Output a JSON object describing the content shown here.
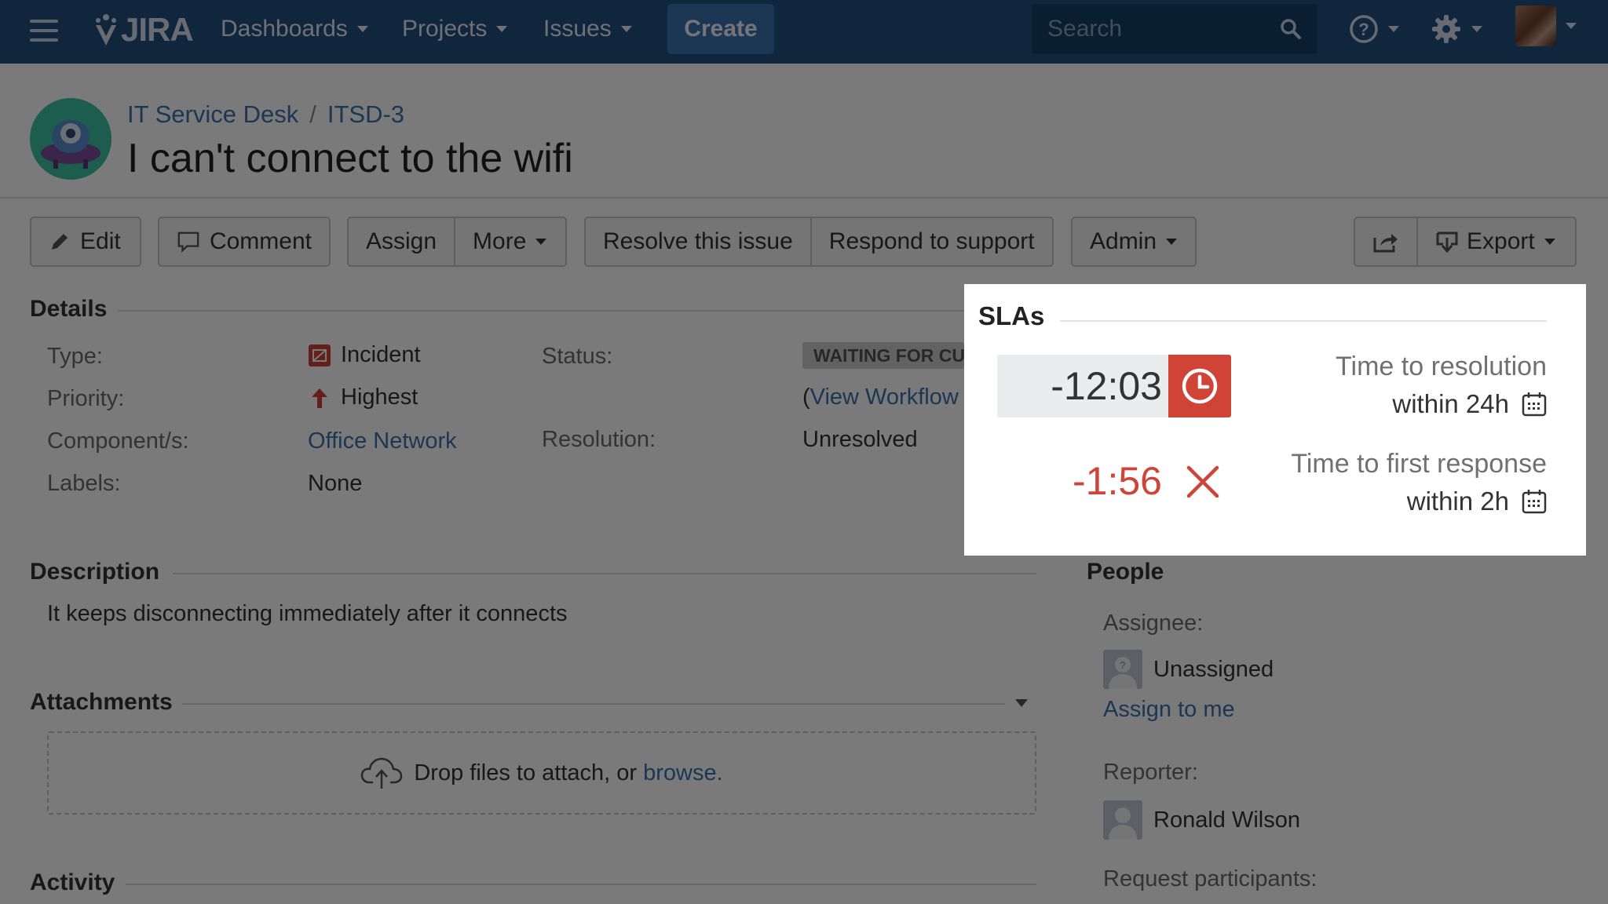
{
  "nav": {
    "logo_text": "JIRA",
    "dashboards": "Dashboards",
    "projects": "Projects",
    "issues": "Issues",
    "create": "Create",
    "search_placeholder": "Search"
  },
  "issue": {
    "project": "IT Service Desk",
    "key": "ITSD-3",
    "title": "I can't connect to the wifi"
  },
  "toolbar": {
    "edit": "Edit",
    "comment": "Comment",
    "assign": "Assign",
    "more": "More",
    "resolve": "Resolve this issue",
    "respond": "Respond to support",
    "admin": "Admin",
    "export": "Export"
  },
  "details": {
    "heading": "Details",
    "type_label": "Type:",
    "type_value": "Incident",
    "priority_label": "Priority:",
    "priority_value": "Highest",
    "components_label": "Component/s:",
    "components_value": "Office Network",
    "labels_label": "Labels:",
    "labels_value": "None",
    "status_label": "Status:",
    "status_value": "WAITING FOR CU",
    "view_workflow_prefix": "(",
    "view_workflow": "View Workflow",
    "resolution_label": "Resolution:",
    "resolution_value": "Unresolved"
  },
  "description": {
    "heading": "Description",
    "text": "It keeps disconnecting immediately after it connects"
  },
  "attachments": {
    "heading": "Attachments",
    "drop_text": "Drop files to attach, or ",
    "browse": "browse."
  },
  "activity": {
    "heading": "Activity"
  },
  "people": {
    "heading": "People",
    "assignee_label": "Assignee:",
    "assignee_value": "Unassigned",
    "assign_to_me": "Assign to me",
    "reporter_label": "Reporter:",
    "reporter_value": "Ronald Wilson",
    "participants_label": "Request participants:"
  },
  "slas": {
    "heading": "SLAs",
    "items": [
      {
        "time": "-12:03",
        "name": "Time to resolution",
        "goal": "within 24h",
        "state": "running-breached"
      },
      {
        "time": "-1:56",
        "name": "Time to first response",
        "goal": "within 2h",
        "state": "breached"
      }
    ]
  },
  "colors": {
    "header": "#205081",
    "create": "#3b73af",
    "link": "#3b73af",
    "breach": "#d04437",
    "priority": "#d04437"
  }
}
